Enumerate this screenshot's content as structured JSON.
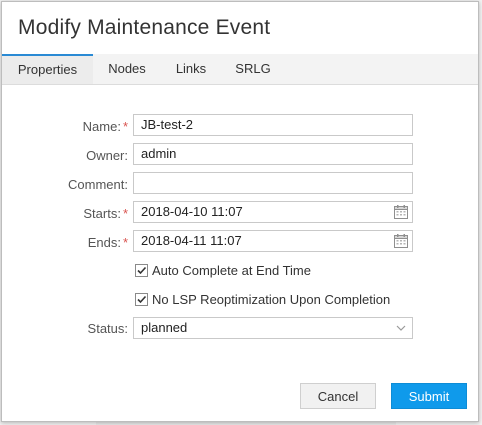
{
  "dialog": {
    "title": "Modify Maintenance Event"
  },
  "tabs": [
    {
      "label": "Properties",
      "active": true
    },
    {
      "label": "Nodes",
      "active": false
    },
    {
      "label": "Links",
      "active": false
    },
    {
      "label": "SRLG",
      "active": false
    }
  ],
  "form": {
    "name": {
      "label": "Name:",
      "required": "*",
      "value": "JB-test-2"
    },
    "owner": {
      "label": "Owner:",
      "value": "admin"
    },
    "comment": {
      "label": "Comment:",
      "value": ""
    },
    "starts": {
      "label": "Starts:",
      "required": "*",
      "value": "2018-04-10 11:07"
    },
    "ends": {
      "label": "Ends:",
      "required": "*",
      "value": "2018-04-11 11:07"
    },
    "auto_complete": {
      "label": "Auto Complete at End Time",
      "checked": true
    },
    "no_lsp": {
      "label": "No LSP Reoptimization Upon Completion",
      "checked": true
    },
    "status": {
      "label": "Status:",
      "value": "planned"
    }
  },
  "buttons": {
    "cancel": "Cancel",
    "submit": "Submit"
  },
  "colors": {
    "accent": "#0f9aeb",
    "required": "#d9534f",
    "tab_indicator": "#2a8ad4"
  },
  "icons": {
    "calendar": "calendar-icon",
    "checkbox_checked": "checkmark-icon",
    "dropdown": "chevron-down-icon"
  }
}
